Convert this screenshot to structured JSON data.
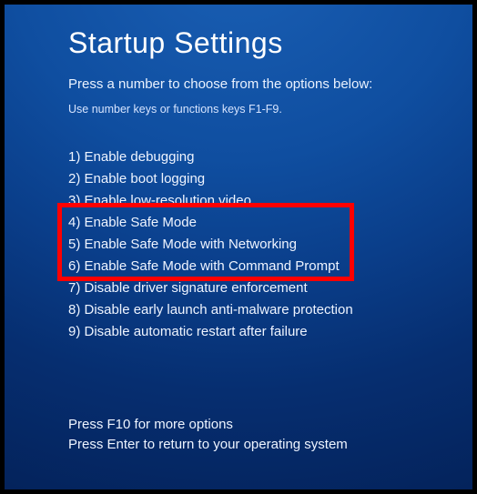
{
  "title": "Startup Settings",
  "subtitle": "Press a number to choose from the options below:",
  "hint": "Use number keys or functions keys F1-F9.",
  "options": [
    {
      "num": "1",
      "label": "Enable debugging"
    },
    {
      "num": "2",
      "label": "Enable boot logging"
    },
    {
      "num": "3",
      "label": "Enable low-resolution video"
    },
    {
      "num": "4",
      "label": "Enable Safe Mode"
    },
    {
      "num": "5",
      "label": "Enable Safe Mode with Networking"
    },
    {
      "num": "6",
      "label": "Enable Safe Mode with Command Prompt"
    },
    {
      "num": "7",
      "label": "Disable driver signature enforcement"
    },
    {
      "num": "8",
      "label": "Disable early launch anti-malware protection"
    },
    {
      "num": "9",
      "label": "Disable automatic restart after failure"
    }
  ],
  "footer": {
    "more": "Press F10 for more options",
    "enter": "Press Enter to return to your operating system"
  },
  "highlight": {
    "color": "#ff0000",
    "covers_options": [
      3,
      4,
      5,
      6
    ]
  }
}
